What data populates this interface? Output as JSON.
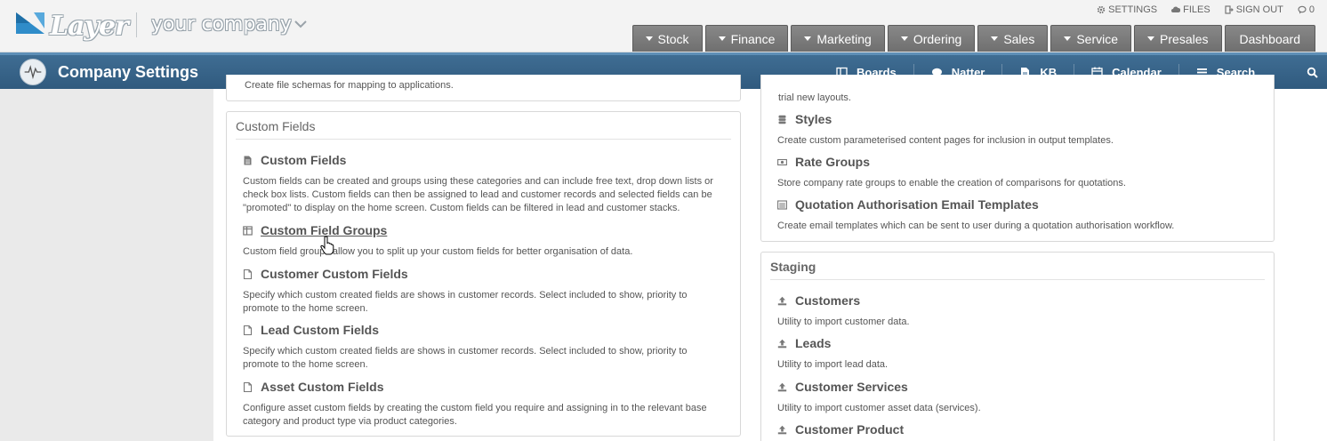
{
  "brand": {
    "logo_word": "Layer",
    "company": "your company"
  },
  "utility": [
    {
      "icon": "gear-icon",
      "label": "SETTINGS"
    },
    {
      "icon": "cloud-icon",
      "label": "FILES"
    },
    {
      "icon": "sign-out-icon",
      "label": "SIGN OUT"
    },
    {
      "icon": "chat-icon",
      "label": "0"
    }
  ],
  "mainnav": [
    {
      "label": "Stock"
    },
    {
      "label": "Finance"
    },
    {
      "label": "Marketing"
    },
    {
      "label": "Ordering"
    },
    {
      "label": "Sales"
    },
    {
      "label": "Service"
    },
    {
      "label": "Presales"
    },
    {
      "label": "Dashboard"
    }
  ],
  "appbar": {
    "title": "Company Settings",
    "nav": [
      {
        "icon": "boards-icon",
        "label": "Boards"
      },
      {
        "icon": "natter-icon",
        "label": "Natter"
      },
      {
        "icon": "kb-icon",
        "label": "KB"
      },
      {
        "icon": "calendar-icon",
        "label": "Calendar"
      },
      {
        "icon": "menu-icon",
        "label": "Search..."
      }
    ]
  },
  "left_top_panel": {
    "desc": "Create file schemas for mapping to applications."
  },
  "custom_fields_panel": {
    "title": "Custom Fields",
    "entries": [
      {
        "icon": "document-icon",
        "label": "Custom Fields",
        "desc": "Custom fields can be created and groups using these categories and can include free text, drop down lists or check box lists. Custom fields can then be assigned to lead and customer records and selected fields can be \"promoted\" to display on the home screen. Custom fields can be filtered in lead and customer stacks."
      },
      {
        "icon": "columns-icon",
        "label": "Custom Field Groups",
        "desc": "Custom field groups allow you to split up your custom fields for better organisation of data."
      },
      {
        "icon": "file-icon",
        "label": "Customer Custom Fields",
        "desc": "Specify which custom created fields are shows in customer records. Select included to show, priority to promote to the home screen."
      },
      {
        "icon": "file-icon",
        "label": "Lead Custom Fields",
        "desc": "Specify which custom created fields are shows in customer records. Select included to show, priority to promote to the home screen."
      },
      {
        "icon": "file-icon",
        "label": "Asset Custom Fields",
        "desc": "Configure asset custom fields by creating the custom field you require and assigning in to the relevant base category and product type via product categories."
      }
    ]
  },
  "right_top_panel": {
    "partial_desc": "trial new layouts.",
    "entries": [
      {
        "icon": "styles-icon",
        "label": "Styles",
        "desc": "Create custom parameterised content pages for inclusion in output templates."
      },
      {
        "icon": "money-icon",
        "label": "Rate Groups",
        "desc": "Store company rate groups to enable the creation of comparisons for quotations."
      },
      {
        "icon": "list-icon",
        "label": "Quotation Authorisation Email Templates",
        "desc": "Create email templates which can be sent to user during a quotation authorisation workflow."
      }
    ]
  },
  "staging_panel": {
    "title": "Staging",
    "entries": [
      {
        "icon": "upload-icon",
        "label": "Customers",
        "desc": "Utility to import customer data."
      },
      {
        "icon": "upload-icon",
        "label": "Leads",
        "desc": "Utility to import lead data."
      },
      {
        "icon": "upload-icon",
        "label": "Customer Services",
        "desc": "Utility to import customer asset data (services)."
      },
      {
        "icon": "upload-icon",
        "label": "Customer Product",
        "desc": ""
      }
    ]
  },
  "colors": {
    "appbar": "#3a6890",
    "tab": "#7a7a7a",
    "logo": "#3b8fc4"
  }
}
